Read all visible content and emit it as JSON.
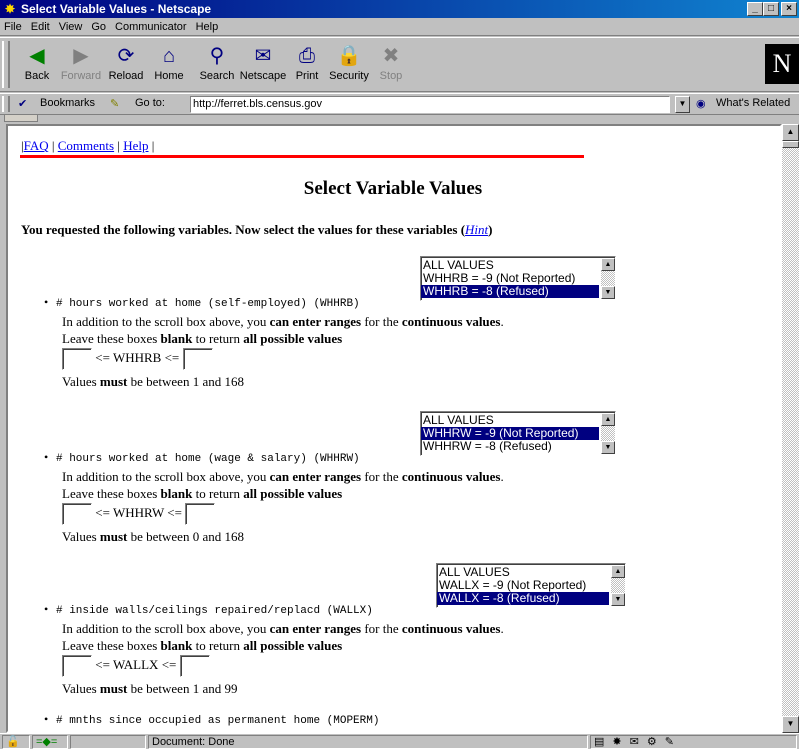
{
  "window": {
    "title": "Select Variable Values - Netscape"
  },
  "menu": [
    "File",
    "Edit",
    "View",
    "Go",
    "Communicator",
    "Help"
  ],
  "toolbar": [
    {
      "label": "Back",
      "icon": "back-arrow-icon",
      "glyph": "◀",
      "color": "#008000",
      "disabled": false
    },
    {
      "label": "Forward",
      "icon": "forward-arrow-icon",
      "glyph": "▶",
      "color": "#808080",
      "disabled": true
    },
    {
      "label": "Reload",
      "icon": "reload-icon",
      "glyph": "⟳",
      "color": "#000080",
      "disabled": false
    },
    {
      "label": "Home",
      "icon": "home-icon",
      "glyph": "⌂",
      "color": "#000080",
      "disabled": false
    },
    {
      "label": "Search",
      "icon": "search-icon",
      "glyph": "⚲",
      "color": "#000080",
      "disabled": false
    },
    {
      "label": "Netscape",
      "icon": "netscape-icon",
      "glyph": "✉",
      "color": "#000080",
      "disabled": false
    },
    {
      "label": "Print",
      "icon": "print-icon",
      "glyph": "⎙",
      "color": "#000080",
      "disabled": false
    },
    {
      "label": "Security",
      "icon": "lock-icon",
      "glyph": "🔒",
      "color": "#806000",
      "disabled": false
    },
    {
      "label": "Stop",
      "icon": "stop-icon",
      "glyph": "✖",
      "color": "#808080",
      "disabled": true
    }
  ],
  "location": {
    "bookmarks_label": "Bookmarks",
    "goto_label": "Go to:",
    "url": "http://ferret.bls.census.gov",
    "related_label": "What's Related"
  },
  "links": {
    "faq": "FAQ",
    "comments": "Comments",
    "help": "Help"
  },
  "page": {
    "title": "Select Variable Values",
    "intro": "You requested the following variables. Now select the values for these variables",
    "hint": "Hint"
  },
  "texts": {
    "range_pre": "In addition to the scroll box above, you",
    "range_bold1": "can enter ranges",
    "range_mid": "for the",
    "range_bold2": "continuous values",
    "blank_pre": "Leave these boxes",
    "blank_bold": "blank",
    "blank_mid": "to return",
    "blank_bold2": "all possible values",
    "must_pre": "Values",
    "must_bold": "must",
    "must_mid": "be between"
  },
  "variables": [
    {
      "name": "# hours worked at home (self-employed) (WHHRB)",
      "code": "WHHRB",
      "options": [
        "ALL VALUES",
        "WHHRB = -9 (Not Reported)",
        "WHHRB = -8 (Refused)"
      ],
      "selected": 2,
      "min": "1",
      "max": "168"
    },
    {
      "name": "# hours worked at home (wage & salary) (WHHRW)",
      "code": "WHHRW",
      "options": [
        "ALL VALUES",
        "WHHRW = -9 (Not Reported)",
        "WHHRW = -8 (Refused)"
      ],
      "selected": 1,
      "min": "0",
      "max": "168"
    },
    {
      "name": "# inside walls/ceilings repaired/replacd (WALLX)",
      "code": "WALLX",
      "options": [
        "ALL VALUES",
        "WALLX = -9 (Not Reported)",
        "WALLX = -8 (Refused)"
      ],
      "selected": 2,
      "min": "1",
      "max": "99"
    },
    {
      "name": "# mnths since occupied as permanent home (MOPERM)"
    }
  ],
  "status": {
    "text": "Document: Done"
  }
}
